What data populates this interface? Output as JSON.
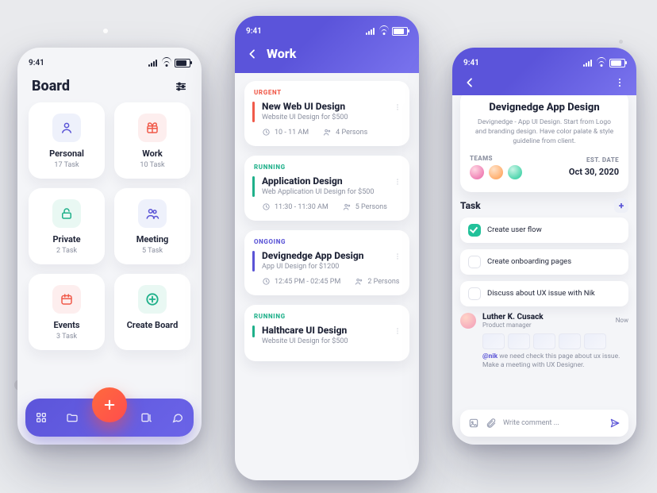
{
  "status_time": "9:41",
  "phone1": {
    "title": "Board",
    "cards": [
      {
        "label": "Personal",
        "sub": "17 Task"
      },
      {
        "label": "Work",
        "sub": "10 Task"
      },
      {
        "label": "Private",
        "sub": "2 Task"
      },
      {
        "label": "Meeting",
        "sub": "5 Task"
      },
      {
        "label": "Events",
        "sub": "3 Task"
      },
      {
        "label": "Create Board",
        "sub": ""
      }
    ]
  },
  "phone2": {
    "title": "Work",
    "tasks": [
      {
        "tag": "URGENT",
        "tagColor": "#f05a4a",
        "title": "New Web UI Design",
        "desc": "Website UI Design for $500",
        "time": "10 - 11 AM",
        "persons": "4 Persons",
        "bar": "#f05a4a"
      },
      {
        "tag": "RUNNING",
        "tagColor": "#1fb08a",
        "title": "Application Design",
        "desc": "Web Application UI Design for $500",
        "time": "11:30 - 11:30 AM",
        "persons": "5 Persons",
        "bar": "#1fb08a"
      },
      {
        "tag": "ONGOING",
        "tagColor": "#5a54d6",
        "title": "Devignedge App Design",
        "desc": "App UI Design for $1200",
        "time": "12:45 PM - 02:45 PM",
        "persons": "2 Persons",
        "bar": "#5a54d6"
      },
      {
        "tag": "RUNNING",
        "tagColor": "#1fb08a",
        "title": "Halthcare UI Design",
        "desc": "Website UI Design for $500",
        "time": "",
        "persons": "",
        "bar": "#1fb08a"
      }
    ]
  },
  "phone3": {
    "title": "Devignedge App Design",
    "blurb": "Devignedge - App UI Design. Start from Logo and branding design. Have color palate & style guideline from client.",
    "teams_label": "TEAMS",
    "est_label": "EST. DATE",
    "est_value": "Oct 30, 2020",
    "task_heading": "Task",
    "tasks": [
      "Create user flow",
      "Create onboarding pages",
      "Discuss about UX issue with Nik"
    ],
    "commenter": {
      "name": "Luther K. Cusack",
      "role": "Product manager",
      "when": "Now"
    },
    "comment_mention": "@nik",
    "comment_rest": " we need check this page about ux issue. Make a meeting with UX Designer.",
    "composer_placeholder": "Write comment ..."
  }
}
